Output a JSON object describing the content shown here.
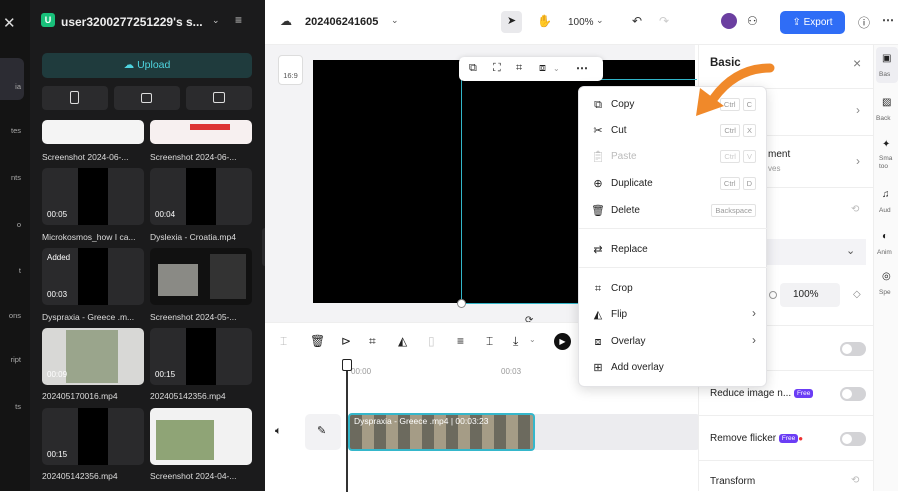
{
  "rail": {
    "items": [
      "ia",
      "tes",
      "nts",
      "o",
      "t",
      "ons",
      "ript",
      "ts"
    ]
  },
  "library": {
    "workspace": "user3200277251229's s...",
    "upload": "Upload",
    "top_labels": [
      "Screenshot 2024-06-...",
      "Screenshot 2024-06-..."
    ],
    "items": [
      {
        "name": "Microkosmos_how I ca...",
        "duration": "00:05"
      },
      {
        "name": "Dyslexia - Croatia.mp4",
        "duration": "00:04"
      },
      {
        "name": "Dyspraxia - Greece .m...",
        "duration": "00:03",
        "badge": "Added"
      },
      {
        "name": "Screenshot 2024-05-...",
        "duration": ""
      },
      {
        "name": "202405170016.mp4",
        "duration": "00:09"
      },
      {
        "name": "202405142356.mp4",
        "duration": "00:15"
      },
      {
        "name": "202405142356.mp4",
        "duration": "00:15"
      },
      {
        "name": "Screenshot 2024-04-...",
        "duration": ""
      }
    ]
  },
  "topbar": {
    "project": "202406241605",
    "zoom": "100%",
    "export": "Export"
  },
  "canvas": {
    "ratio": "16:9"
  },
  "context_menu": {
    "items": [
      {
        "label": "Copy",
        "shortcut": [
          "Ctrl",
          "C"
        ]
      },
      {
        "label": "Cut",
        "shortcut": [
          "Ctrl",
          "X"
        ]
      },
      {
        "label": "Paste",
        "shortcut": [
          "Ctrl",
          "V"
        ],
        "disabled": true
      },
      {
        "label": "Duplicate",
        "shortcut": [
          "Ctrl",
          "D"
        ]
      },
      {
        "label": "Delete",
        "shortcut": [
          "Backspace"
        ]
      },
      {
        "label": "Replace"
      },
      {
        "label": "Crop"
      },
      {
        "label": "Flip",
        "submenu": true
      },
      {
        "label": "Overlay",
        "submenu": true
      },
      {
        "label": "Add overlay"
      }
    ]
  },
  "timeline": {
    "ticks": [
      "00:00",
      "00:03"
    ],
    "clip": "Dyspraxia - Greece .mp4 | 00:03:23"
  },
  "right_panel": {
    "title": "Basic",
    "row1_partial": "ment",
    "row1_sub": "ves",
    "opacity": "100%",
    "reduce_noise": "Reduce image n...",
    "remove_flicker": "Remove flicker",
    "free_badge": "Free",
    "transform": "Transform"
  },
  "far_right": [
    "Bas",
    "Back",
    "Sma too",
    "Aud",
    "Anim",
    "Spe"
  ]
}
